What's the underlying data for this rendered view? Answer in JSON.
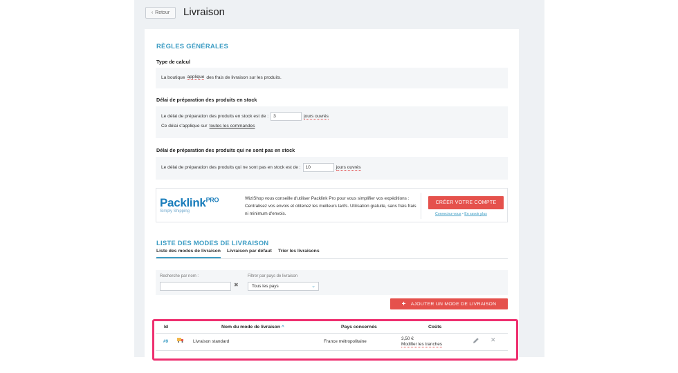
{
  "header": {
    "back_label": "Retour",
    "page_title": "Livraison"
  },
  "general": {
    "section_title": "RÈGLES GÉNÉRALES",
    "calc_label": "Type de calcul",
    "calc_text_pre": "La boutique",
    "calc_text_link": "applique",
    "calc_text_post": "des frais de livraison sur les produits.",
    "instock_label": "Délai de préparation des produits en stock",
    "instock_text": "Le délai de préparation des produits en stock est de :",
    "instock_value": "3",
    "instock_unit": "jours ouvrés",
    "instock_note_pre": "Ce délai s'applique sur",
    "instock_note_link": "toutes les commandes",
    "outstock_label": "Délai de préparation des produits qui ne sont pas en stock",
    "outstock_text": "Le délai de préparation des produits qui ne sont pas en stock est de :",
    "outstock_value": "10",
    "outstock_unit": "jours ouvrés"
  },
  "packlink": {
    "logo_text": "Packlink",
    "logo_pro": "PRO",
    "logo_sub": "Simply Shipping",
    "description": "WiziShop vous conseille d'utiliser Packlink Pro pour vous simplifier vos expéditions : Centralisez vos envois et obtenez les meilleurs tarifs. Utilisation gratuite, sans frais frais ni minimum d'envois.",
    "create_button": "CRÉER VOTRE COMPTE",
    "connect_link": "Connectez-vous",
    "separator": "•",
    "more_link": "En savoir plus"
  },
  "modes": {
    "section_title": "LISTE DES MODES DE LIVRAISON",
    "tabs": [
      {
        "label": "Liste des modes de livraison"
      },
      {
        "label": "Livraison par défaut"
      },
      {
        "label": "Trier les livraisons"
      }
    ],
    "filter": {
      "search_label": "Recherche par nom :",
      "search_value": "",
      "clear": "✖",
      "country_label": "Filtrer par pays de livraison",
      "country_selected": "Tous les pays"
    },
    "add_button": "AJOUTER UN MODE DE LIVRAISON",
    "table": {
      "columns": {
        "id": "Id",
        "name": "Nom du mode de livraison",
        "sort_arrow": "^",
        "countries": "Pays concernés",
        "costs": "Coûts"
      },
      "rows": [
        {
          "id": "#9",
          "name": "Livraison standard",
          "countries": "France métropolitaine",
          "cost": "3,50 €",
          "cost_link": "Modifier les tranches"
        }
      ]
    }
  },
  "colors": {
    "accent": "#3d9dc4",
    "button_red": "#e5514c",
    "highlight": "#ee2f6f"
  }
}
